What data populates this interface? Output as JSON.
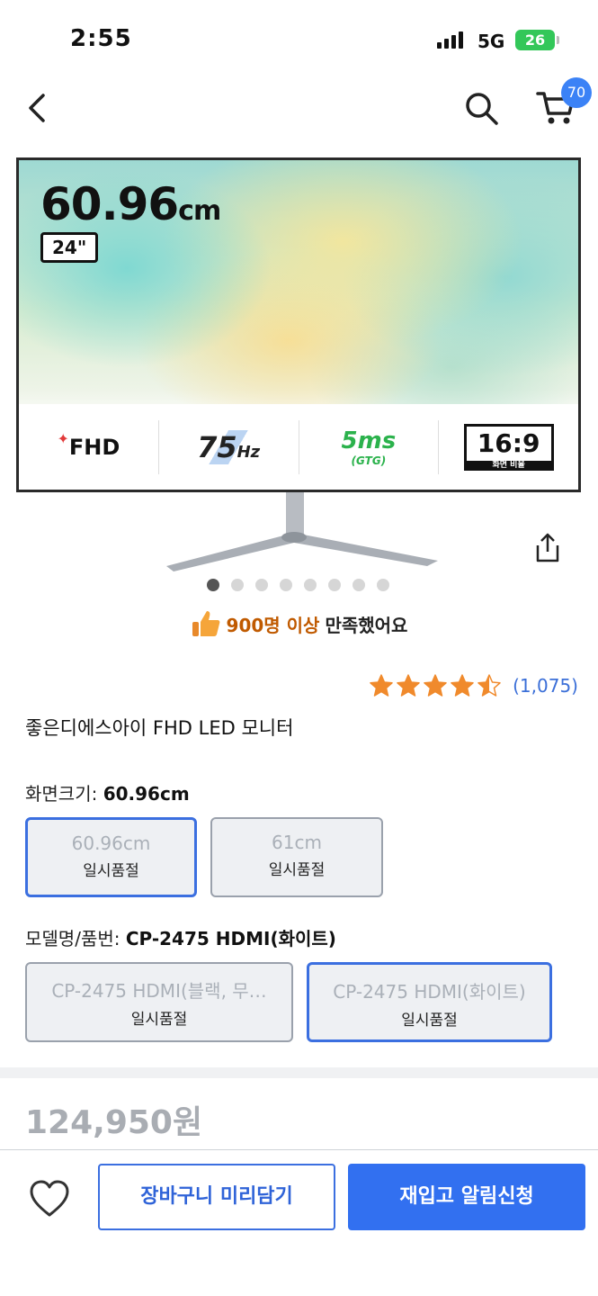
{
  "status_bar": {
    "time": "2:55",
    "network": "5G",
    "battery": "26"
  },
  "nav": {
    "cart_count": "70"
  },
  "hero": {
    "size_value": "60.96",
    "size_unit": "cm",
    "inch_label": "24\"",
    "spec_fhd": "FHD",
    "spec_hz_value": "75",
    "spec_hz_unit": "Hz",
    "spec_ms_value": "5ms",
    "spec_ms_sub": "(GTG)",
    "spec_ratio_value": "16:9",
    "spec_ratio_sub": "화면 비율"
  },
  "carousel": {
    "total": 8,
    "active_index": 0
  },
  "satisfaction": {
    "highlight": "900명 이상",
    "rest": "만족했어요"
  },
  "rating": {
    "stars": 4.5,
    "count": "(1,075)",
    "star_color": "#f08a2c"
  },
  "product": {
    "title": "좋은디에스아이 FHD LED 모니터"
  },
  "option_size": {
    "label": "화면크기: ",
    "selected": "60.96cm",
    "choices": [
      {
        "name": "60.96cm",
        "status": "일시품절"
      },
      {
        "name": "61cm",
        "status": "일시품절"
      }
    ]
  },
  "option_model": {
    "label": "모델명/품번: ",
    "selected": "CP-2475 HDMI(화이트)",
    "choices": [
      {
        "name": "CP-2475 HDMI(블랙, 무…",
        "status": "일시품절"
      },
      {
        "name": "CP-2475 HDMI(화이트)",
        "status": "일시품절"
      }
    ]
  },
  "price": "124,950원",
  "actions": {
    "cart_button": "장바구니 미리담기",
    "notify_button": "재입고 알림신청"
  },
  "colors": {
    "accent": "#3270f0",
    "price_muted": "#a9adb3",
    "satisfaction": "#c05a00"
  }
}
